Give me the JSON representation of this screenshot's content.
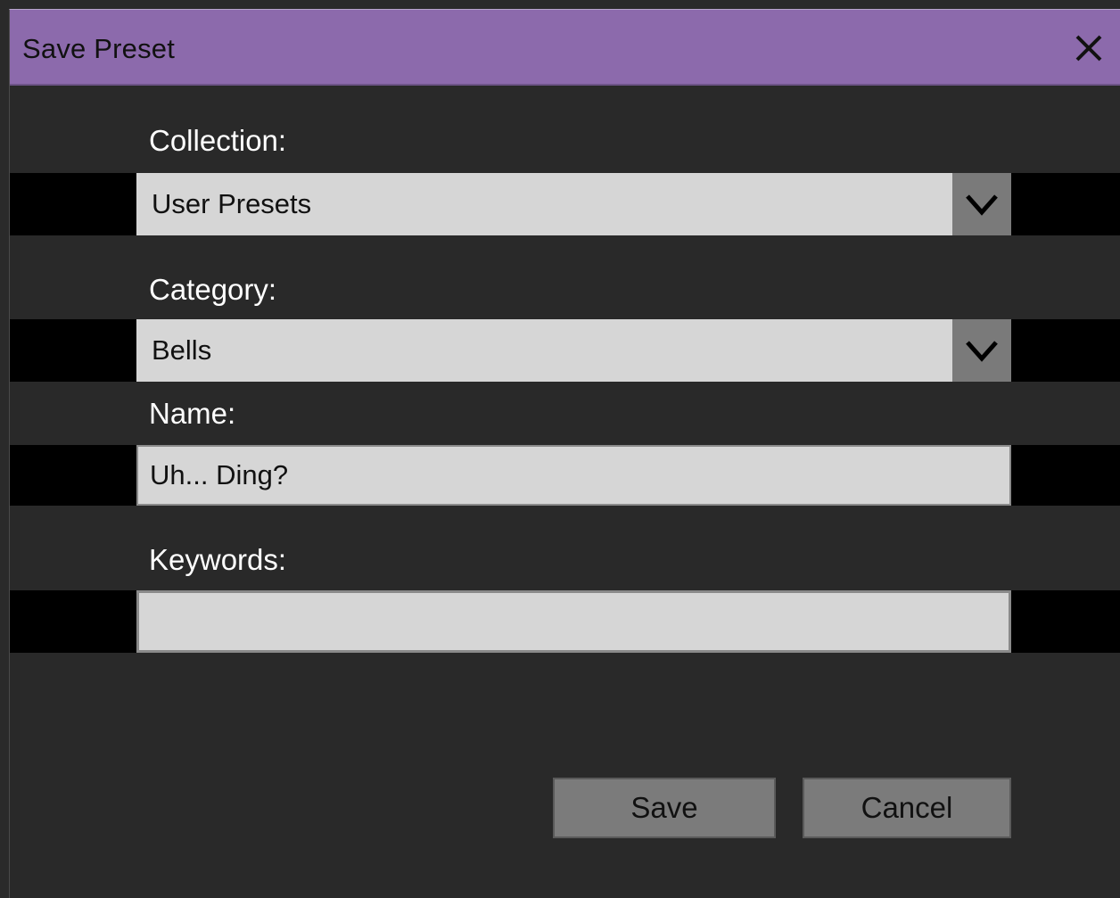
{
  "dialog": {
    "title": "Save Preset",
    "close_icon": "close-icon"
  },
  "collection": {
    "label": "Collection:",
    "selected": "User Presets",
    "icon": "chevron-down-icon"
  },
  "category": {
    "label": "Category:",
    "selected": "Bells",
    "icon": "chevron-down-icon"
  },
  "name": {
    "label": "Name:",
    "value": "Uh... Ding?"
  },
  "keywords": {
    "label": "Keywords:",
    "value": ""
  },
  "buttons": {
    "save_label": "Save",
    "cancel_label": "Cancel"
  },
  "colors": {
    "titlebar": "#8c6aac",
    "background": "#292929",
    "field": "#d6d6d6",
    "button": "#7b7b7b"
  }
}
